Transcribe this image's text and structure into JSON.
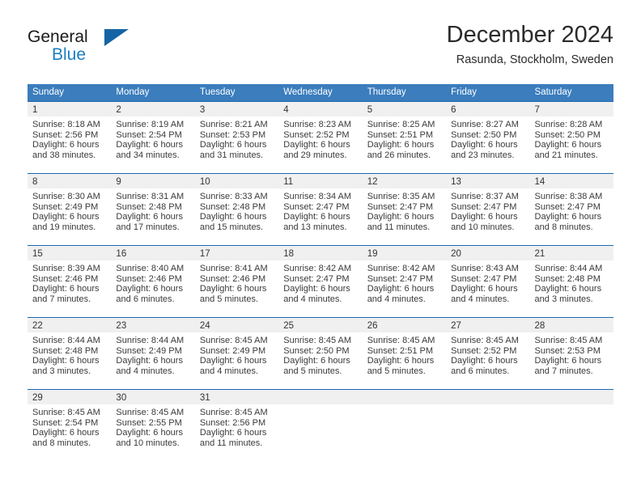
{
  "brand": {
    "name_top": "General",
    "name_bottom": "Blue",
    "accent_color": "#1a7fc1",
    "triangle_color": "#1464a5"
  },
  "header": {
    "title": "December 2024",
    "subtitle": "Rasunda, Stockholm, Sweden"
  },
  "calendar": {
    "header_bg": "#3b7dbd",
    "row_divider_color": "#1f69ad",
    "daynum_band_color": "#f0f0f0",
    "weekdays": [
      "Sunday",
      "Monday",
      "Tuesday",
      "Wednesday",
      "Thursday",
      "Friday",
      "Saturday"
    ],
    "weeks": [
      [
        {
          "day": "1",
          "sunrise": "Sunrise: 8:18 AM",
          "sunset": "Sunset: 2:56 PM",
          "daylight_line1": "Daylight: 6 hours",
          "daylight_line2": "and 38 minutes."
        },
        {
          "day": "2",
          "sunrise": "Sunrise: 8:19 AM",
          "sunset": "Sunset: 2:54 PM",
          "daylight_line1": "Daylight: 6 hours",
          "daylight_line2": "and 34 minutes."
        },
        {
          "day": "3",
          "sunrise": "Sunrise: 8:21 AM",
          "sunset": "Sunset: 2:53 PM",
          "daylight_line1": "Daylight: 6 hours",
          "daylight_line2": "and 31 minutes."
        },
        {
          "day": "4",
          "sunrise": "Sunrise: 8:23 AM",
          "sunset": "Sunset: 2:52 PM",
          "daylight_line1": "Daylight: 6 hours",
          "daylight_line2": "and 29 minutes."
        },
        {
          "day": "5",
          "sunrise": "Sunrise: 8:25 AM",
          "sunset": "Sunset: 2:51 PM",
          "daylight_line1": "Daylight: 6 hours",
          "daylight_line2": "and 26 minutes."
        },
        {
          "day": "6",
          "sunrise": "Sunrise: 8:27 AM",
          "sunset": "Sunset: 2:50 PM",
          "daylight_line1": "Daylight: 6 hours",
          "daylight_line2": "and 23 minutes."
        },
        {
          "day": "7",
          "sunrise": "Sunrise: 8:28 AM",
          "sunset": "Sunset: 2:50 PM",
          "daylight_line1": "Daylight: 6 hours",
          "daylight_line2": "and 21 minutes."
        }
      ],
      [
        {
          "day": "8",
          "sunrise": "Sunrise: 8:30 AM",
          "sunset": "Sunset: 2:49 PM",
          "daylight_line1": "Daylight: 6 hours",
          "daylight_line2": "and 19 minutes."
        },
        {
          "day": "9",
          "sunrise": "Sunrise: 8:31 AM",
          "sunset": "Sunset: 2:48 PM",
          "daylight_line1": "Daylight: 6 hours",
          "daylight_line2": "and 17 minutes."
        },
        {
          "day": "10",
          "sunrise": "Sunrise: 8:33 AM",
          "sunset": "Sunset: 2:48 PM",
          "daylight_line1": "Daylight: 6 hours",
          "daylight_line2": "and 15 minutes."
        },
        {
          "day": "11",
          "sunrise": "Sunrise: 8:34 AM",
          "sunset": "Sunset: 2:47 PM",
          "daylight_line1": "Daylight: 6 hours",
          "daylight_line2": "and 13 minutes."
        },
        {
          "day": "12",
          "sunrise": "Sunrise: 8:35 AM",
          "sunset": "Sunset: 2:47 PM",
          "daylight_line1": "Daylight: 6 hours",
          "daylight_line2": "and 11 minutes."
        },
        {
          "day": "13",
          "sunrise": "Sunrise: 8:37 AM",
          "sunset": "Sunset: 2:47 PM",
          "daylight_line1": "Daylight: 6 hours",
          "daylight_line2": "and 10 minutes."
        },
        {
          "day": "14",
          "sunrise": "Sunrise: 8:38 AM",
          "sunset": "Sunset: 2:47 PM",
          "daylight_line1": "Daylight: 6 hours",
          "daylight_line2": "and 8 minutes."
        }
      ],
      [
        {
          "day": "15",
          "sunrise": "Sunrise: 8:39 AM",
          "sunset": "Sunset: 2:46 PM",
          "daylight_line1": "Daylight: 6 hours",
          "daylight_line2": "and 7 minutes."
        },
        {
          "day": "16",
          "sunrise": "Sunrise: 8:40 AM",
          "sunset": "Sunset: 2:46 PM",
          "daylight_line1": "Daylight: 6 hours",
          "daylight_line2": "and 6 minutes."
        },
        {
          "day": "17",
          "sunrise": "Sunrise: 8:41 AM",
          "sunset": "Sunset: 2:46 PM",
          "daylight_line1": "Daylight: 6 hours",
          "daylight_line2": "and 5 minutes."
        },
        {
          "day": "18",
          "sunrise": "Sunrise: 8:42 AM",
          "sunset": "Sunset: 2:47 PM",
          "daylight_line1": "Daylight: 6 hours",
          "daylight_line2": "and 4 minutes."
        },
        {
          "day": "19",
          "sunrise": "Sunrise: 8:42 AM",
          "sunset": "Sunset: 2:47 PM",
          "daylight_line1": "Daylight: 6 hours",
          "daylight_line2": "and 4 minutes."
        },
        {
          "day": "20",
          "sunrise": "Sunrise: 8:43 AM",
          "sunset": "Sunset: 2:47 PM",
          "daylight_line1": "Daylight: 6 hours",
          "daylight_line2": "and 4 minutes."
        },
        {
          "day": "21",
          "sunrise": "Sunrise: 8:44 AM",
          "sunset": "Sunset: 2:48 PM",
          "daylight_line1": "Daylight: 6 hours",
          "daylight_line2": "and 3 minutes."
        }
      ],
      [
        {
          "day": "22",
          "sunrise": "Sunrise: 8:44 AM",
          "sunset": "Sunset: 2:48 PM",
          "daylight_line1": "Daylight: 6 hours",
          "daylight_line2": "and 3 minutes."
        },
        {
          "day": "23",
          "sunrise": "Sunrise: 8:44 AM",
          "sunset": "Sunset: 2:49 PM",
          "daylight_line1": "Daylight: 6 hours",
          "daylight_line2": "and 4 minutes."
        },
        {
          "day": "24",
          "sunrise": "Sunrise: 8:45 AM",
          "sunset": "Sunset: 2:49 PM",
          "daylight_line1": "Daylight: 6 hours",
          "daylight_line2": "and 4 minutes."
        },
        {
          "day": "25",
          "sunrise": "Sunrise: 8:45 AM",
          "sunset": "Sunset: 2:50 PM",
          "daylight_line1": "Daylight: 6 hours",
          "daylight_line2": "and 5 minutes."
        },
        {
          "day": "26",
          "sunrise": "Sunrise: 8:45 AM",
          "sunset": "Sunset: 2:51 PM",
          "daylight_line1": "Daylight: 6 hours",
          "daylight_line2": "and 5 minutes."
        },
        {
          "day": "27",
          "sunrise": "Sunrise: 8:45 AM",
          "sunset": "Sunset: 2:52 PM",
          "daylight_line1": "Daylight: 6 hours",
          "daylight_line2": "and 6 minutes."
        },
        {
          "day": "28",
          "sunrise": "Sunrise: 8:45 AM",
          "sunset": "Sunset: 2:53 PM",
          "daylight_line1": "Daylight: 6 hours",
          "daylight_line2": "and 7 minutes."
        }
      ],
      [
        {
          "day": "29",
          "sunrise": "Sunrise: 8:45 AM",
          "sunset": "Sunset: 2:54 PM",
          "daylight_line1": "Daylight: 6 hours",
          "daylight_line2": "and 8 minutes."
        },
        {
          "day": "30",
          "sunrise": "Sunrise: 8:45 AM",
          "sunset": "Sunset: 2:55 PM",
          "daylight_line1": "Daylight: 6 hours",
          "daylight_line2": "and 10 minutes."
        },
        {
          "day": "31",
          "sunrise": "Sunrise: 8:45 AM",
          "sunset": "Sunset: 2:56 PM",
          "daylight_line1": "Daylight: 6 hours",
          "daylight_line2": "and 11 minutes."
        },
        {
          "day": "",
          "sunrise": "",
          "sunset": "",
          "daylight_line1": "",
          "daylight_line2": ""
        },
        {
          "day": "",
          "sunrise": "",
          "sunset": "",
          "daylight_line1": "",
          "daylight_line2": ""
        },
        {
          "day": "",
          "sunrise": "",
          "sunset": "",
          "daylight_line1": "",
          "daylight_line2": ""
        },
        {
          "day": "",
          "sunrise": "",
          "sunset": "",
          "daylight_line1": "",
          "daylight_line2": ""
        }
      ]
    ]
  }
}
